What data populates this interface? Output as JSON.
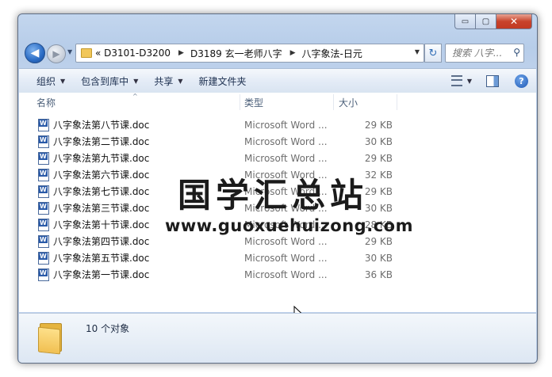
{
  "window": {
    "caption": {
      "minimize": "▭",
      "maximize": "▢",
      "close": "✕"
    }
  },
  "nav": {
    "back_icon": "◀",
    "forward_icon": "▶",
    "history_icon": "▼",
    "breadcrumbs": [
      "«  D3101-D3200",
      "D3189 玄一老师八字",
      "八字象法-日元"
    ],
    "separator": "▶",
    "address_dropdown": "▼",
    "refresh_icon": "↻",
    "search_placeholder": "搜索 八字...",
    "search_icon": "⚲"
  },
  "toolbar": {
    "organize": "组织",
    "include_in_library": "包含到库中",
    "share": "共享",
    "new_folder": "新建文件夹",
    "dropdown": "▼",
    "help": "?"
  },
  "columns": {
    "name": "名称",
    "type": "类型",
    "size": "大小",
    "sort_indicator": "^"
  },
  "files": [
    {
      "name": "八字象法第八节课.doc",
      "type": "Microsoft Word ...",
      "size": "29 KB"
    },
    {
      "name": "八字象法第二节课.doc",
      "type": "Microsoft Word ...",
      "size": "30 KB"
    },
    {
      "name": "八字象法第九节课.doc",
      "type": "Microsoft Word ...",
      "size": "29 KB"
    },
    {
      "name": "八字象法第六节课.doc",
      "type": "Microsoft Word ...",
      "size": "32 KB"
    },
    {
      "name": "八字象法第七节课.doc",
      "type": "Microsoft Word ...",
      "size": "29 KB"
    },
    {
      "name": "八字象法第三节课.doc",
      "type": "Microsoft Word ...",
      "size": "30 KB"
    },
    {
      "name": "八字象法第十节课.doc",
      "type": "Microsoft Word ...",
      "size": "28 KB"
    },
    {
      "name": "八字象法第四节课.doc",
      "type": "Microsoft Word ...",
      "size": "29 KB"
    },
    {
      "name": "八字象法第五节课.doc",
      "type": "Microsoft Word ...",
      "size": "30 KB"
    },
    {
      "name": "八字象法第一节课.doc",
      "type": "Microsoft Word ...",
      "size": "36 KB"
    }
  ],
  "watermark": {
    "chinese": "国学汇总站",
    "url": "www.guoxuehuizong.com"
  },
  "details": {
    "item_count": "10 个对象"
  },
  "colors": {
    "accent": "#2a6bc4",
    "close": "#c8432b",
    "folder": "#f1c75a"
  }
}
